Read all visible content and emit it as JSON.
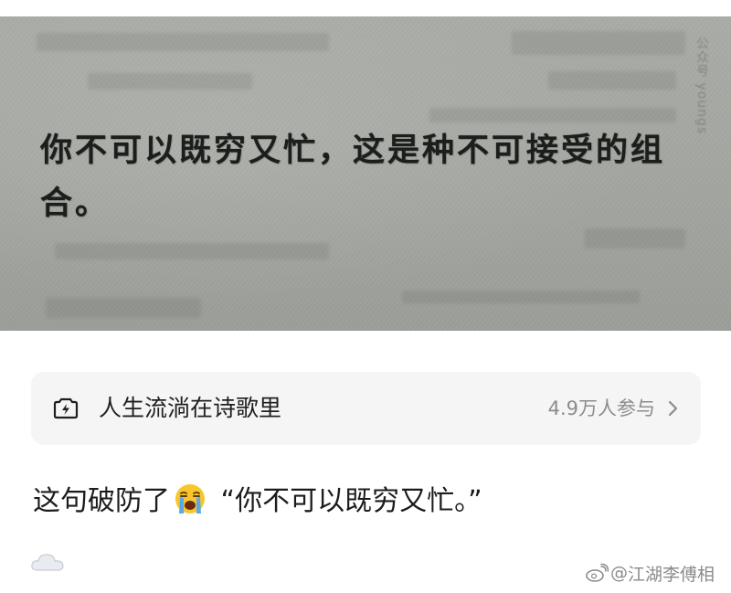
{
  "photo": {
    "quote_text": "你不可以既穷又忙，这是种不可接受的组合。",
    "side_text": "公众号 youngs"
  },
  "topic": {
    "title": "人生流淌在诗歌里",
    "count": "4.9万人参与",
    "icon": "lightning-camera-icon",
    "chevron": "chevron-right-icon"
  },
  "post": {
    "text_before": "这句破防了",
    "emoji": "loudly-crying-face-emoji",
    "text_after": " “你不可以既穷又忙。”",
    "cloud_emoji": "cloud-emoji"
  },
  "watermark": {
    "at": "@",
    "author": "江湖李傅相",
    "logo": "weibo-logo"
  },
  "colors": {
    "card_bg": "#f5f5f6",
    "muted_text": "#8c8c8c",
    "body_text": "#1c1c1c",
    "photo_paper": "#a5a8a2"
  }
}
